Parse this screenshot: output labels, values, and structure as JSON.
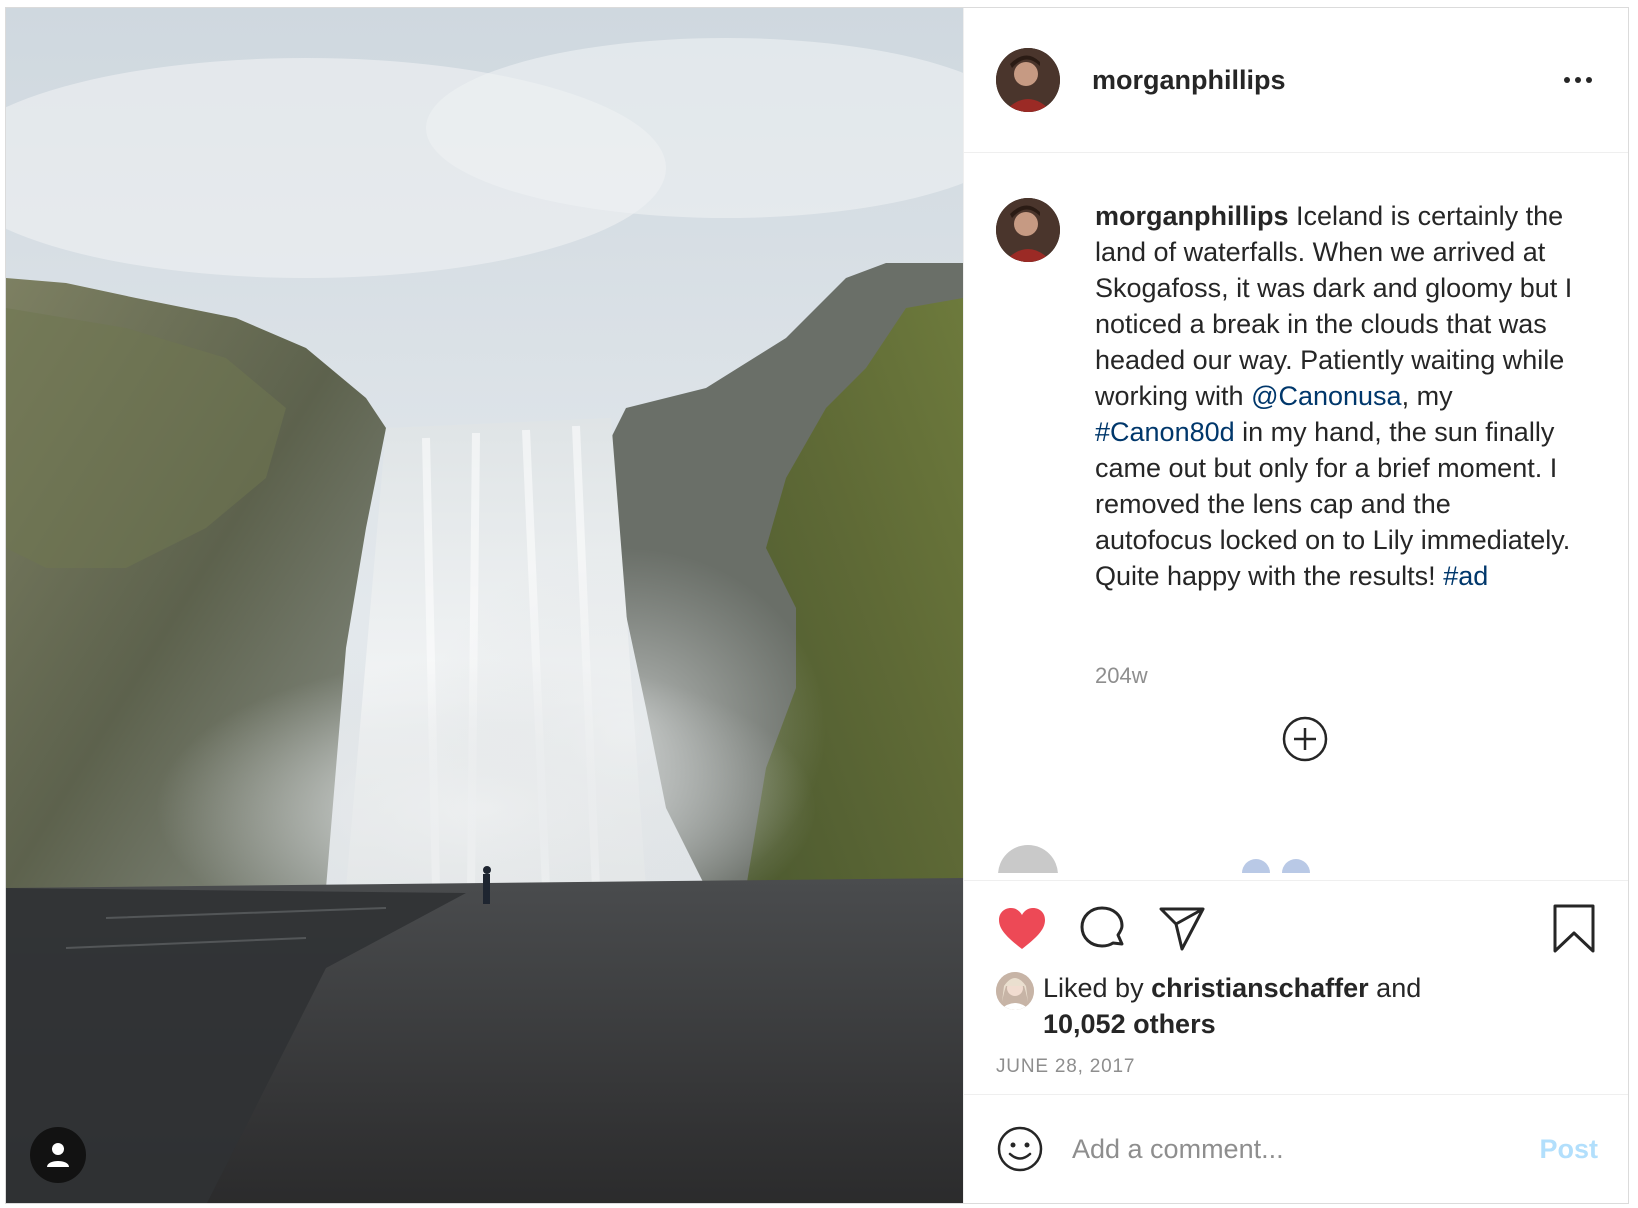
{
  "post": {
    "username": "morganphillips",
    "caption": {
      "username": "morganphillips",
      "part1": " Iceland is certainly the land of waterfalls. When we arrived at Skogafoss, it was dark and gloomy but I noticed a break in the clouds that was headed our way. Patiently waiting while working with ",
      "mention": "@Canonusa",
      "part2": ", my ",
      "hashtag1": "#Canon80d",
      "part3": " in my hand, the sun finally came out but only for a brief moment. I removed the lens cap and the autofocus locked on to Lily immediately. Quite happy with the results! ",
      "hashtag2": "#ad"
    },
    "caption_age": "204w",
    "likes": {
      "prefix": "Liked by ",
      "user": "christianschaffer",
      "middle": " and",
      "others": "10,052 others"
    },
    "date": "JUNE 28, 2017",
    "liked": true
  },
  "comment_box": {
    "placeholder": "Add a comment...",
    "post_label": "Post"
  },
  "icons": {
    "more": "more-options-icon",
    "load_more": "plus-circle-icon",
    "like": "heart-icon",
    "comment": "comment-bubble-icon",
    "share": "paper-plane-icon",
    "save": "bookmark-icon",
    "emoji": "smiley-icon",
    "user_tags": "person-icon"
  },
  "colors": {
    "like_red": "#ed4956",
    "link_blue": "#00376b",
    "post_disabled": "#b2dffc",
    "secondary_text": "#8e8e8e"
  }
}
